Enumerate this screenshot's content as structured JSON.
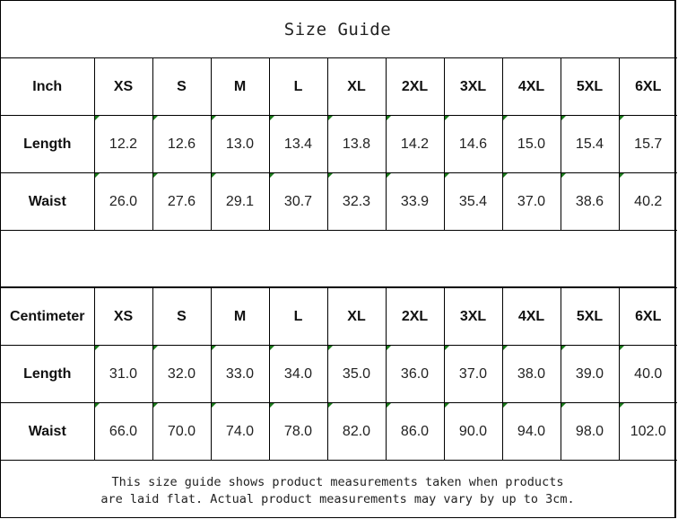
{
  "title": "Size Guide",
  "sizes": [
    "XS",
    "S",
    "M",
    "L",
    "XL",
    "2XL",
    "3XL",
    "4XL",
    "5XL",
    "6XL"
  ],
  "inch_table": {
    "unit_label": "Inch",
    "rows": [
      {
        "label": "Length",
        "values": [
          "12.2",
          "12.6",
          "13.0",
          "13.4",
          "13.8",
          "14.2",
          "14.6",
          "15.0",
          "15.4",
          "15.7"
        ]
      },
      {
        "label": "Waist",
        "values": [
          "26.0",
          "27.6",
          "29.1",
          "30.7",
          "32.3",
          "33.9",
          "35.4",
          "37.0",
          "38.6",
          "40.2"
        ]
      }
    ]
  },
  "cm_table": {
    "unit_label": "Centimeter",
    "rows": [
      {
        "label": "Length",
        "values": [
          "31.0",
          "32.0",
          "33.0",
          "34.0",
          "35.0",
          "36.0",
          "37.0",
          "38.0",
          "39.0",
          "40.0"
        ]
      },
      {
        "label": "Waist",
        "values": [
          "66.0",
          "70.0",
          "74.0",
          "78.0",
          "82.0",
          "86.0",
          "90.0",
          "94.0",
          "98.0",
          "102.0"
        ]
      }
    ]
  },
  "note": {
    "line1": "This size guide shows product measurements taken when products",
    "line2": "are laid flat. Actual product measurements may vary by up to 3cm."
  },
  "colors": {
    "border": "#000000",
    "cell_marker": "#1b7a1b"
  }
}
